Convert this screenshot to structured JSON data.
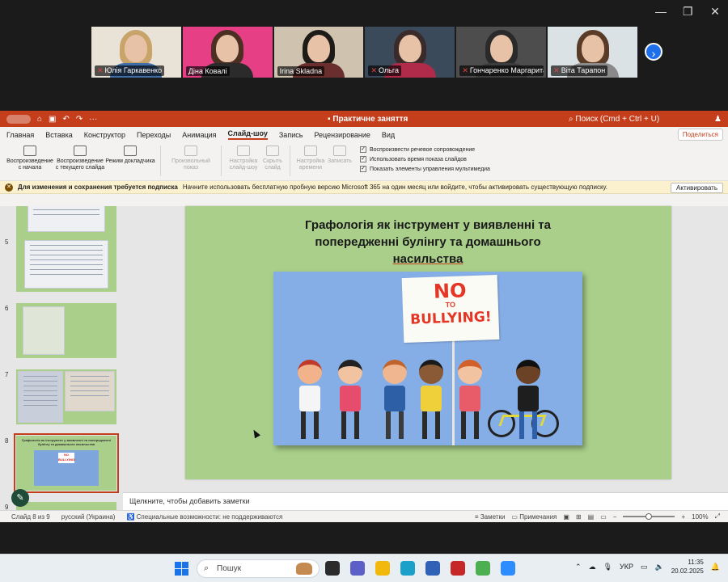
{
  "window_controls": {
    "minimize": "—",
    "restore": "❐",
    "close": "✕"
  },
  "participants": [
    {
      "name": "Юлія Гаркавенко",
      "muted": true,
      "bg": "#e9e3d7",
      "hair": "#c8a36a",
      "body": "#3f6ea8"
    },
    {
      "name": "Діна Ковалі",
      "muted": false,
      "bg": "#e63f86",
      "hair": "#4a2f22",
      "body": "#2b2b2b"
    },
    {
      "name": "Irina Skladna",
      "muted": false,
      "bg": "#cfc3b0",
      "hair": "#1e1a18",
      "body": "#6a2e2e"
    },
    {
      "name": "Ольга",
      "muted": true,
      "bg": "#3b4a5a",
      "hair": "#3a2a2a",
      "body": "#b02a4a"
    },
    {
      "name": "Гончаренко Маргарита",
      "muted": true,
      "bg": "#4d4d4d",
      "hair": "#2a2a2a",
      "body": "#3c3c3c"
    },
    {
      "name": "Віта Тарапон",
      "muted": true,
      "bg": "#dbe2e6",
      "hair": "#5a3b28",
      "body": "#8a8a8a"
    }
  ],
  "ppt": {
    "doc_title": "Практичне заняття",
    "search_placeholder": "Поиск (Cmd + Ctrl + U)",
    "menu": [
      "Главная",
      "Вставка",
      "Конструктор",
      "Переходы",
      "Анимация",
      "Слайд-шоу",
      "Запись",
      "Рецензирование",
      "Вид"
    ],
    "active_menu": "Слайд-шоу",
    "share_label": "Поделиться",
    "ribbon_buttons": [
      {
        "label": "Воспроизведение с начала",
        "disabled": false
      },
      {
        "label": "Воспроизведение с текущего слайда",
        "disabled": false
      },
      {
        "label": "Режим докладчика",
        "disabled": false
      },
      {
        "label": "Произвольный показ",
        "disabled": true
      },
      {
        "label": "Настройка слайд-шоу",
        "disabled": true
      },
      {
        "label": "Скрыть слайд",
        "disabled": true
      },
      {
        "label": "Настройка времени",
        "disabled": true
      },
      {
        "label": "Записать",
        "disabled": true
      }
    ],
    "checkboxes": [
      "Воспроизвести речевое сопровождение",
      "Использовать время показа слайдов",
      "Показать элементы управления мультимедиа"
    ],
    "notice": {
      "bold": "Для изменения и сохранения требуется подписка",
      "text": "Начните использовать бесплатную пробную версию Microsoft 365 на один месяц или войдите, чтобы активировать существующую подписку.",
      "button": "Активировать"
    },
    "thumbnails": [
      "5",
      "6",
      "7",
      "8",
      "9"
    ],
    "selected_thumbnail": "8",
    "slide": {
      "title_line1": "Графологія як інструмент  у виявленні та",
      "title_line2": "попередженні булінгу та домашнього",
      "title_line3": "насильства",
      "sign_no": "NO",
      "sign_to": "TO",
      "sign_bully": "BULLYING!"
    },
    "notes_placeholder": "Щелкните, чтобы добавить заметки",
    "status": {
      "slide_of": "Слайд 8 из 9",
      "language": "русский (Украина)",
      "accessibility": "Специальные возможности: не поддерживаются",
      "notes": "Заметки",
      "comments": "Примечания",
      "zoom": "100%"
    }
  },
  "taskbar": {
    "search_label": "Пошук",
    "lang": "УКР",
    "time": "11:35",
    "date": "20.02.2025",
    "apps": [
      {
        "name": "task-view",
        "color": "#2b2b2b"
      },
      {
        "name": "chat",
        "color": "#5b5fc7"
      },
      {
        "name": "explorer",
        "color": "#f2b90c"
      },
      {
        "name": "edge",
        "color": "#1aa0c9"
      },
      {
        "name": "store",
        "color": "#2f61b6"
      },
      {
        "name": "mail",
        "color": "#c62828"
      },
      {
        "name": "chrome",
        "color": "#4caf50"
      },
      {
        "name": "zoom",
        "color": "#2d8cff"
      }
    ]
  }
}
